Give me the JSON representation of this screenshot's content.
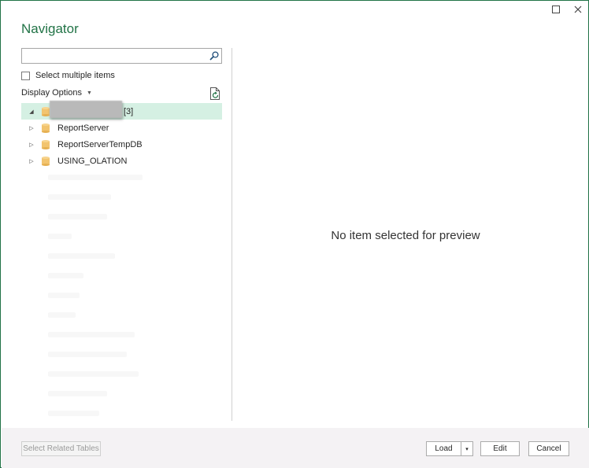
{
  "window": {
    "title": "Navigator",
    "controls": [
      {
        "name": "maximize",
        "glyph": "☐"
      },
      {
        "name": "close",
        "glyph": "✕"
      }
    ]
  },
  "search": {
    "value": "",
    "placeholder": "",
    "icon": "search-icon"
  },
  "select_multiple": {
    "label": "Select multiple items",
    "checked": false
  },
  "display_options": {
    "label": "Display Options",
    "caret": "▼"
  },
  "tree": {
    "root": {
      "suffix": "[3]",
      "expanded": true,
      "selected": true,
      "expander": "◢"
    },
    "children": [
      {
        "label": "ReportServer",
        "expander": "▷"
      },
      {
        "label": "ReportServerTempDB",
        "expander": "▷"
      },
      {
        "label": "USING_OLATION",
        "expander": "▷"
      }
    ]
  },
  "preview": {
    "message": "No item selected for preview"
  },
  "footer": {
    "select_related": "Select Related Tables",
    "load": "Load",
    "load_caret": "▾",
    "edit": "Edit",
    "cancel": "Cancel"
  },
  "colors": {
    "accent": "#217346",
    "selection": "#d5f0e3",
    "db_icon": "#f2c46f",
    "footer_bg": "#f4f2f4"
  }
}
